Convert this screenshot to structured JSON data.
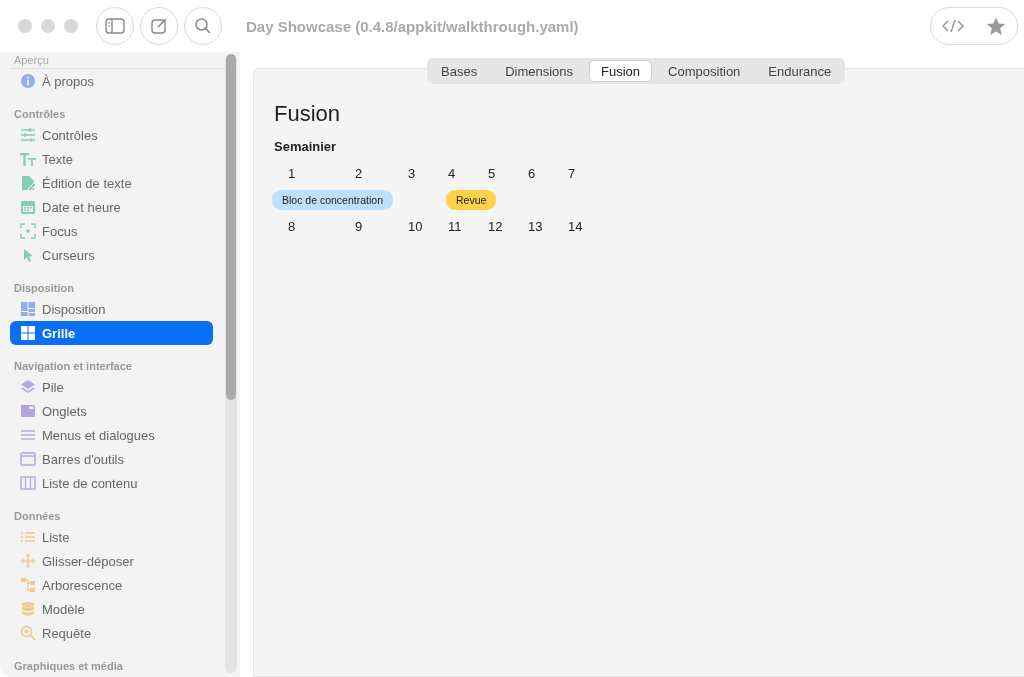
{
  "window": {
    "title": "Day Showcase (0.4.8/appkit/walkthrough.yaml)"
  },
  "sidebar": {
    "sections": [
      {
        "title": "Aperçu",
        "items": [
          {
            "label": "À propos",
            "selected": false
          }
        ]
      },
      {
        "title": "Contrôles",
        "items": [
          {
            "label": "Contrôles",
            "selected": false
          },
          {
            "label": "Texte",
            "selected": false
          },
          {
            "label": "Édition de texte",
            "selected": false
          },
          {
            "label": "Date et heure",
            "selected": false
          },
          {
            "label": "Focus",
            "selected": false
          },
          {
            "label": "Curseurs",
            "selected": false
          }
        ]
      },
      {
        "title": "Disposition",
        "items": [
          {
            "label": "Disposition",
            "selected": false
          },
          {
            "label": "Grille",
            "selected": true
          }
        ]
      },
      {
        "title": "Navigation et interface",
        "items": [
          {
            "label": "Pile",
            "selected": false
          },
          {
            "label": "Onglets",
            "selected": false
          },
          {
            "label": "Menus et dialogues",
            "selected": false
          },
          {
            "label": "Barres d'outils",
            "selected": false
          },
          {
            "label": "Liste de contenu",
            "selected": false
          }
        ]
      },
      {
        "title": "Données",
        "items": [
          {
            "label": "Liste",
            "selected": false
          },
          {
            "label": "Glisser-déposer",
            "selected": false
          },
          {
            "label": "Arborescence",
            "selected": false
          },
          {
            "label": "Modèle",
            "selected": false
          },
          {
            "label": "Requête",
            "selected": false
          }
        ]
      },
      {
        "title": "Graphiques et média"
      }
    ]
  },
  "tabs": [
    {
      "label": "Bases",
      "selected": false
    },
    {
      "label": "Dimensions",
      "selected": false
    },
    {
      "label": "Fusion",
      "selected": true
    },
    {
      "label": "Composition",
      "selected": false
    },
    {
      "label": "Endurance",
      "selected": false
    }
  ],
  "content": {
    "heading": "Fusion",
    "calendar": {
      "title": "Semainier",
      "weeks": [
        {
          "days": [
            {
              "number": "1",
              "event": {
                "label": "Bloc de concentration",
                "color": "#bfe0fa"
              }
            },
            {
              "number": "2"
            },
            {
              "number": "3"
            },
            {
              "number": "4",
              "event": {
                "label": "Revue",
                "color": "#fdd14a"
              }
            },
            {
              "number": "5"
            },
            {
              "number": "6"
            },
            {
              "number": "7"
            }
          ]
        },
        {
          "days": [
            {
              "number": "8"
            },
            {
              "number": "9"
            },
            {
              "number": "10"
            },
            {
              "number": "11"
            },
            {
              "number": "12"
            },
            {
              "number": "13"
            },
            {
              "number": "14"
            }
          ]
        }
      ]
    }
  }
}
